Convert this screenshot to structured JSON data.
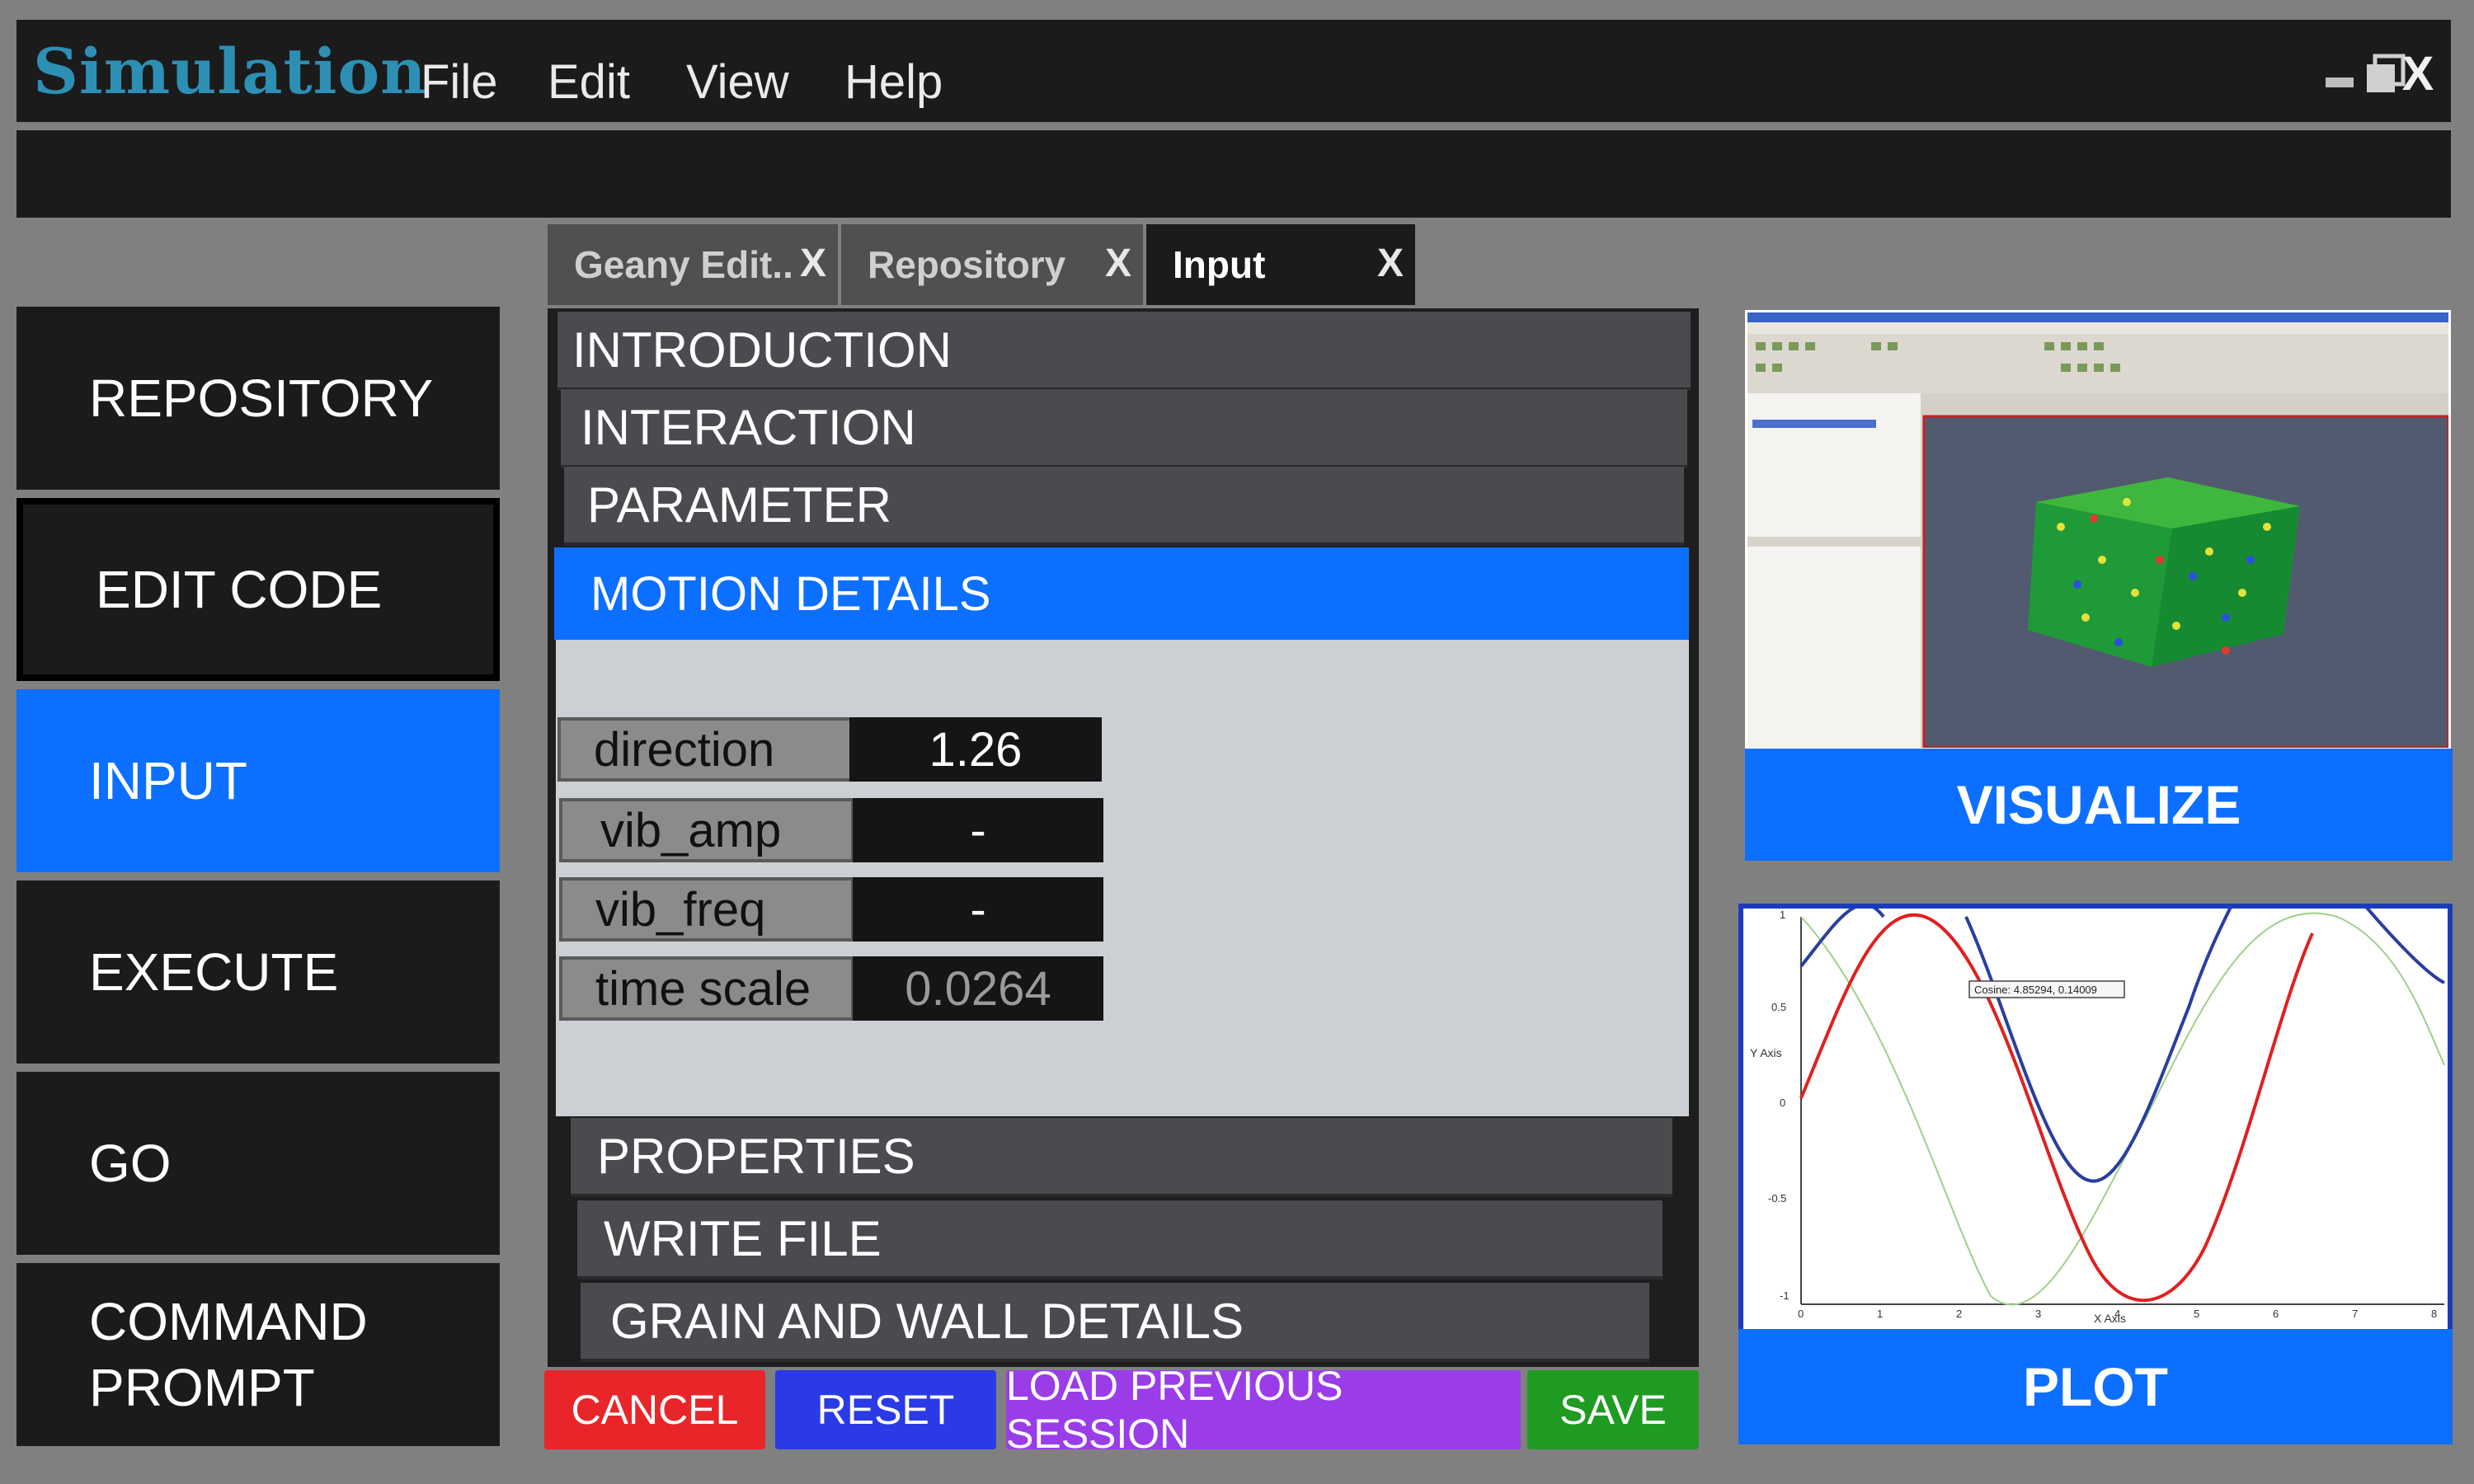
{
  "app": {
    "title": "Simulation"
  },
  "menu": [
    "File",
    "Edit",
    "View",
    "Help"
  ],
  "window_controls": {
    "close": "X"
  },
  "sidebar": [
    {
      "label": "REPOSITORY",
      "active": false
    },
    {
      "label": "EDIT CODE",
      "active": false
    },
    {
      "label": "INPUT",
      "active": true
    },
    {
      "label": "EXECUTE",
      "active": false
    },
    {
      "label": "GO",
      "active": false
    },
    {
      "label": "COMMAND PROMPT",
      "active": false
    }
  ],
  "tabs": [
    {
      "label": "Geany Edit..",
      "close": "X",
      "active": false
    },
    {
      "label": "Repository",
      "close": "X",
      "active": false
    },
    {
      "label": "Input",
      "close": "X",
      "active": true
    }
  ],
  "sections": {
    "introduction": "INTRODUCTION",
    "interaction": "INTERACTION",
    "parameter": "PARAMETER",
    "motion_details": "MOTION DETAILS",
    "properties": "PROPERTIES",
    "write_file": "WRITE FILE",
    "grain_wall": "GRAIN AND WALL DETAILS"
  },
  "params": [
    {
      "label": "direction",
      "value": "1.26"
    },
    {
      "label": "vib_amp",
      "value": "-"
    },
    {
      "label": "vib_freq",
      "value": "-"
    },
    {
      "label": "time scale",
      "value": "0.0264"
    }
  ],
  "buttons": {
    "cancel": "CANCEL",
    "reset": "RESET",
    "load": "LOAD PREVIOUS SESSION",
    "save": "SAVE"
  },
  "visualize": {
    "label": "VISUALIZE"
  },
  "plot": {
    "label": "PLOT",
    "ylabel": "Y Axis",
    "xlabel": "X Axis",
    "tooltip": "Cosine: 4.85294, 0.14009",
    "yticks": [
      "1",
      "0.5",
      "0",
      "-0.5",
      "-1"
    ],
    "xticks": [
      "0",
      "1",
      "2",
      "3",
      "4",
      "5",
      "6",
      "7",
      "8"
    ]
  },
  "colors": {
    "accent": "#0c6fff",
    "dark": "#1b1b1b",
    "cancel": "#e8262a",
    "reset": "#2a3ae6",
    "load": "#9a3de8",
    "save": "#1f9b22"
  }
}
